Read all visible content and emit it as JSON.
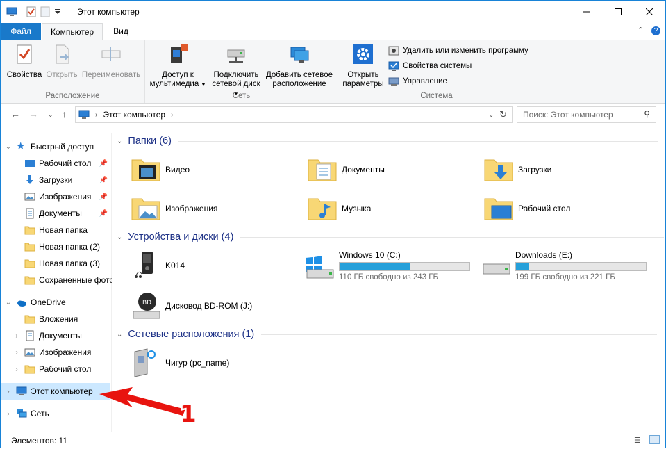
{
  "titlebar": {
    "title": "Этот компьютер",
    "minimize_icon": "minimize-icon",
    "maximize_icon": "maximize-icon",
    "close_icon": "close-icon"
  },
  "tabs": {
    "file": "Файл",
    "computer": "Компьютер",
    "view": "Вид"
  },
  "ribbon": {
    "location": {
      "label": "Расположение",
      "properties": "Свойства",
      "open": "Открыть",
      "rename": "Переименовать"
    },
    "network": {
      "label": "Сеть",
      "media_line1": "Доступ к",
      "media_line2": "мультимедиа",
      "map_line1": "Подключить",
      "map_line2": "сетевой диск",
      "add_line1": "Добавить сетевое",
      "add_line2": "расположение"
    },
    "system": {
      "label": "Система",
      "open_line1": "Открыть",
      "open_line2": "параметры",
      "uninstall": "Удалить или изменить программу",
      "sys_props": "Свойства системы",
      "manage": "Управление"
    }
  },
  "address": {
    "path": "Этот компьютер",
    "search_placeholder": "Поиск: Этот компьютер"
  },
  "navpane": {
    "quick_access": "Быстрый доступ",
    "quick_items": [
      "Рабочий стол",
      "Загрузки",
      "Изображения",
      "Документы",
      "Новая папка",
      "Новая папка (2)",
      "Новая папка (3)",
      "Сохраненные фото"
    ],
    "onedrive": "OneDrive",
    "onedrive_items": [
      "Вложения",
      "Документы",
      "Изображения",
      "Рабочий стол"
    ],
    "this_pc": "Этот компьютер",
    "network": "Сеть"
  },
  "content": {
    "folders_header": "Папки (6)",
    "folders": [
      "Видео",
      "Документы",
      "Загрузки",
      "Изображения",
      "Музыка",
      "Рабочий стол"
    ],
    "devices_header": "Устройства и диски (4)",
    "devices": {
      "k014": "K014",
      "c_name": "Windows 10 (C:)",
      "c_free": "110 ГБ свободно из 243 ГБ",
      "c_used_fraction": 0.547,
      "e_name": "Downloads (E:)",
      "e_free": "199 ГБ свободно из 221 ГБ",
      "e_used_fraction": 0.1,
      "bd": "Дисковод BD-ROM (J:)"
    },
    "network_header": "Сетевые расположения (1)",
    "network_items": [
      "Чигур (pc_name)"
    ]
  },
  "status": {
    "items": "Элементов: 11"
  },
  "annotation": {
    "number": "1",
    "color": "#e8140f"
  },
  "colors": {
    "accent": "#1979ca",
    "header": "#1e3287",
    "selected": "#cce8ff",
    "drive_bar": "#26a0da"
  }
}
